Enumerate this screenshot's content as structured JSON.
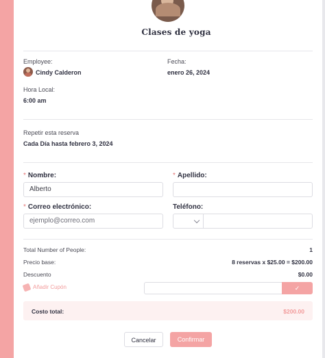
{
  "header": {
    "title": "Clases de yoga"
  },
  "details": {
    "employee_label": "Employee:",
    "employee_name": "Cindy Calderon",
    "fecha_label": "Fecha:",
    "fecha_value": "enero 26, 2024",
    "hora_label": "Hora Local:",
    "hora_value": "6:00 am",
    "repeat_label": "Repetir esta reserva",
    "repeat_value": "Cada Día hasta febrero 3, 2024"
  },
  "form": {
    "required_mark": "*",
    "nombre_label": "Nombre:",
    "nombre_value": "Alberto",
    "apellido_label": "Apellido:",
    "apellido_value": "",
    "email_label": "Correo electrónico:",
    "email_placeholder": "ejemplo@correo.com",
    "telefono_label": "Teléfono:",
    "telefono_value": ""
  },
  "summary": {
    "people_label": "Total Number of People:",
    "people_value": "1",
    "base_label": "Precio base:",
    "base_value": "8 reservas x $25.00 = $200.00",
    "discount_label": "Descuento",
    "discount_value": "$0.00",
    "coupon_label": "Añadir Cupón",
    "coupon_apply_icon": "✓",
    "total_label": "Costo total:",
    "total_value": "$200.00"
  },
  "actions": {
    "cancel_label": "Cancelar",
    "confirm_label": "Confirmar"
  },
  "colors": {
    "accent": "#f4a4a4",
    "accent_text": "#f29a9a",
    "total_bg": "#fdf1f1"
  }
}
